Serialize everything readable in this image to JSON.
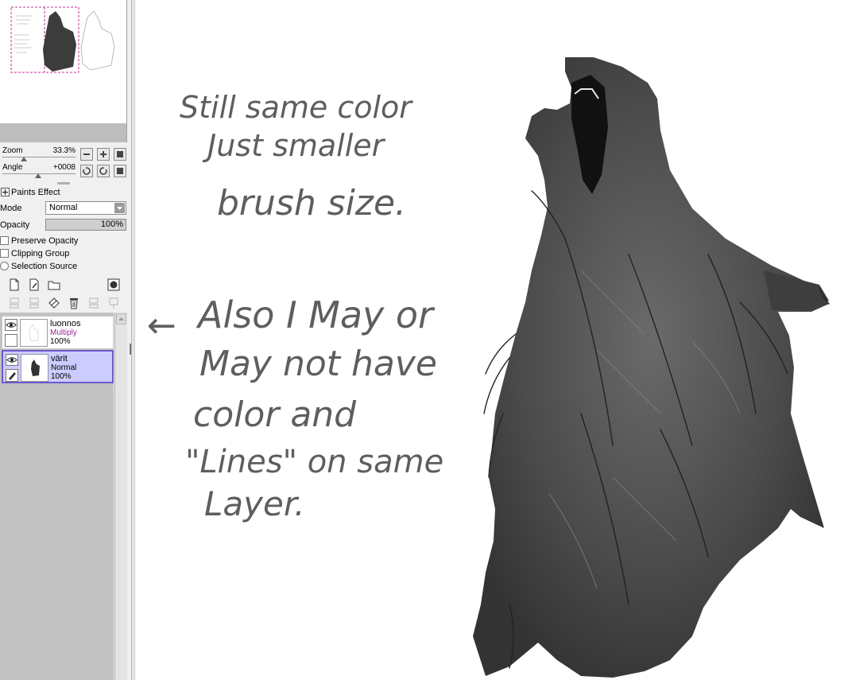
{
  "navigator": {
    "thumbnail": "canvas-preview"
  },
  "view": {
    "zoom_label": "Zoom",
    "zoom_value": "33.3%",
    "angle_label": "Angle",
    "angle_value": "+0008"
  },
  "layer_props": {
    "paints_effect": "Paints Effect",
    "mode_label": "Mode",
    "mode_value": "Normal",
    "opacity_label": "Opacity",
    "opacity_value": "100%",
    "opacity_fraction": 1.0,
    "preserve_opacity": "Preserve Opacity",
    "clipping_group": "Clipping Group",
    "selection_source": "Selection Source"
  },
  "layers": [
    {
      "name": "luonnos",
      "mode": "Multiply",
      "opacity": "100%",
      "selected": false
    },
    {
      "name": "värit",
      "mode": "Normal",
      "opacity": "100%",
      "selected": true
    }
  ],
  "annotations": {
    "line1": "Still same color",
    "line2": "Just smaller",
    "line3": "brush size.",
    "arrow": "←",
    "line4": "Also I May or",
    "line5": "May not have",
    "line6": "color and",
    "line7": "\"Lines\" on same",
    "line8": "Layer."
  },
  "colors": {
    "selected_layer_bg": "#ccccff",
    "selected_layer_border": "#6a5acd",
    "multiply_text": "#9a2a9a",
    "wolf_fur": "#4a4a4a",
    "handwriting": "#5e5e5e"
  }
}
